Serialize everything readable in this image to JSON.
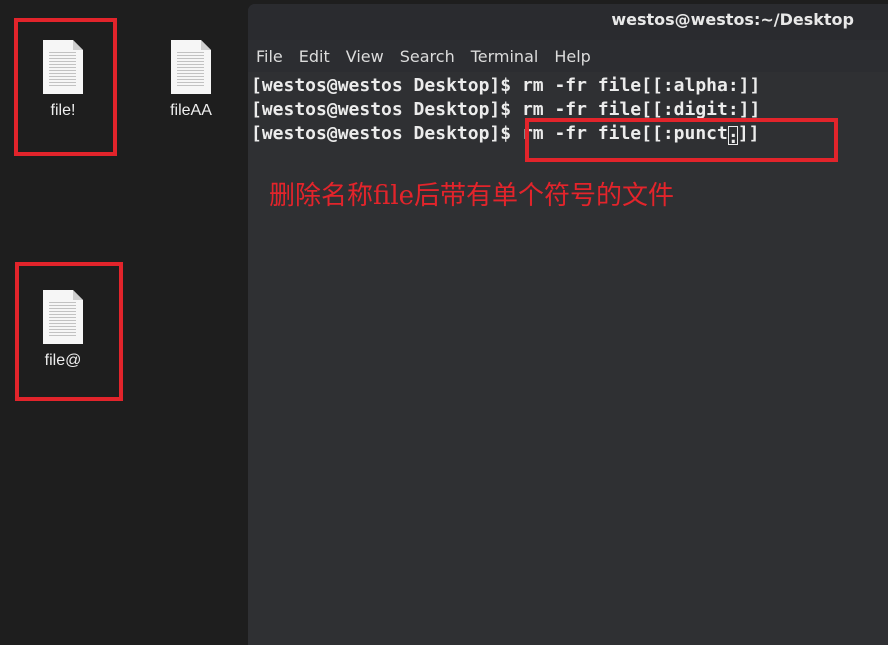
{
  "desktop": {
    "icons": [
      {
        "label": "file!",
        "icon": "text-document-icon"
      },
      {
        "label": "fileAA",
        "icon": "text-document-icon"
      },
      {
        "label": "file@",
        "icon": "text-document-icon"
      }
    ]
  },
  "terminal": {
    "title": "westos@westos:~/Desktop",
    "menu": [
      "File",
      "Edit",
      "View",
      "Search",
      "Terminal",
      "Help"
    ],
    "prompt": "[westos@westos Desktop]$",
    "lines": [
      "rm -fr file[[:alpha:]]",
      "rm -fr file[[:digit:]]"
    ],
    "current_line": {
      "before_cursor": "rm -fr file[[:punct",
      "cursor_char": ":",
      "after_cursor": "]]"
    }
  },
  "annotation": {
    "text": "删除名称file后带有单个符号的文件",
    "color": "#e3242b"
  },
  "colors": {
    "highlight_box": "#e2242b",
    "terminal_bg": "#2f3033",
    "desktop_bg": "#1e1e1e"
  }
}
